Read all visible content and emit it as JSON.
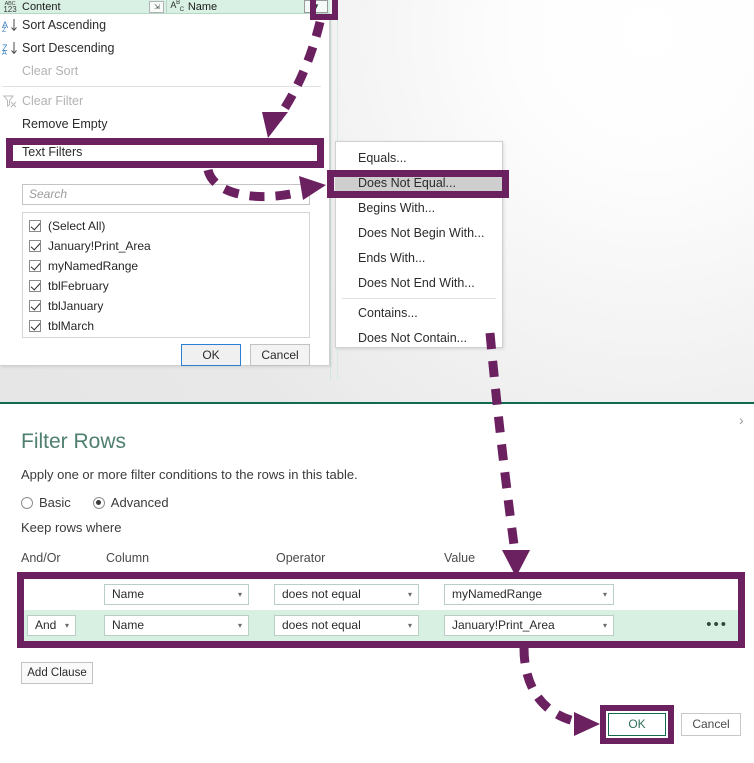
{
  "column_header": {
    "content_col": {
      "type_glyph_top": "ABC",
      "type_glyph_bottom": "123",
      "label": "Content"
    },
    "expand_icon": "expand-collapse-icon",
    "name_col": {
      "type_glyph": "ABC",
      "label": "Name"
    },
    "dropdown_icon": "chevron-down-icon"
  },
  "filter_menu": {
    "items": [
      {
        "label": "Sort Ascending",
        "icon": "sort-ascending-icon",
        "disabled": false
      },
      {
        "label": "Sort Descending",
        "icon": "sort-descending-icon",
        "disabled": false
      },
      {
        "label": "Clear Sort",
        "icon": "clear-sort-icon",
        "disabled": true
      },
      {
        "label": "Clear Filter",
        "icon": "clear-filter-icon",
        "disabled": true
      },
      {
        "label": "Remove Empty",
        "icon": "remove-empty-icon",
        "disabled": false
      }
    ],
    "text_filters": {
      "label": "Text Filters",
      "caret": "▸"
    },
    "search": {
      "placeholder": "Search",
      "value": ""
    },
    "checklist": [
      {
        "label": "(Select All)",
        "checked": true
      },
      {
        "label": "January!Print_Area",
        "checked": true
      },
      {
        "label": "myNamedRange",
        "checked": true
      },
      {
        "label": "tblFebruary",
        "checked": true
      },
      {
        "label": "tblJanuary",
        "checked": true
      },
      {
        "label": "tblMarch",
        "checked": true
      }
    ],
    "ok_label": "OK",
    "cancel_label": "Cancel"
  },
  "text_filters_submenu": {
    "items": [
      {
        "label": "Equals...",
        "highlighted": false
      },
      {
        "label": "Does Not Equal...",
        "highlighted": true
      },
      {
        "label": "Begins With...",
        "highlighted": false
      },
      {
        "label": "Does Not Begin With...",
        "highlighted": false
      },
      {
        "label": "Ends With...",
        "highlighted": false
      },
      {
        "label": "Does Not End With...",
        "highlighted": false
      },
      {
        "label": "Contains...",
        "highlighted": false
      },
      {
        "label": "Does Not Contain...",
        "highlighted": false
      }
    ]
  },
  "filter_rows_dialog": {
    "title": "Filter Rows",
    "description": "Apply one or more filter conditions to the rows in this table.",
    "modes": [
      {
        "label": "Basic",
        "selected": false
      },
      {
        "label": "Advanced",
        "selected": true
      }
    ],
    "keep_rows_label": "Keep rows where",
    "column_headers": {
      "and_or": "And/Or",
      "column": "Column",
      "operator": "Operator",
      "value": "Value"
    },
    "clauses": [
      {
        "and_or": "",
        "column": "Name",
        "operator": "does not equal",
        "value": "myNamedRange",
        "show_ellipsis": false
      },
      {
        "and_or": "And",
        "column": "Name",
        "operator": "does not equal",
        "value": "January!Print_Area",
        "show_ellipsis": true
      }
    ],
    "add_clause_label": "Add Clause",
    "ok_label": "OK",
    "cancel_label": "Cancel",
    "ellipsis_label": "•••",
    "caret_glyph": "▾"
  },
  "annotations": {
    "highlight_color": "#6b2060",
    "boxes": [
      "dropdown-arrow-highlight",
      "text-filters-highlight",
      "does-not-equal-highlight",
      "filter-clauses-highlight",
      "ok-button-highlight"
    ],
    "arrows": [
      "arrow-dropdown-to-text-filters",
      "arrow-text-filters-to-submenu",
      "arrow-submenu-to-value-column",
      "arrow-clauses-to-ok"
    ]
  },
  "misc": {
    "chevron_right": "›"
  }
}
